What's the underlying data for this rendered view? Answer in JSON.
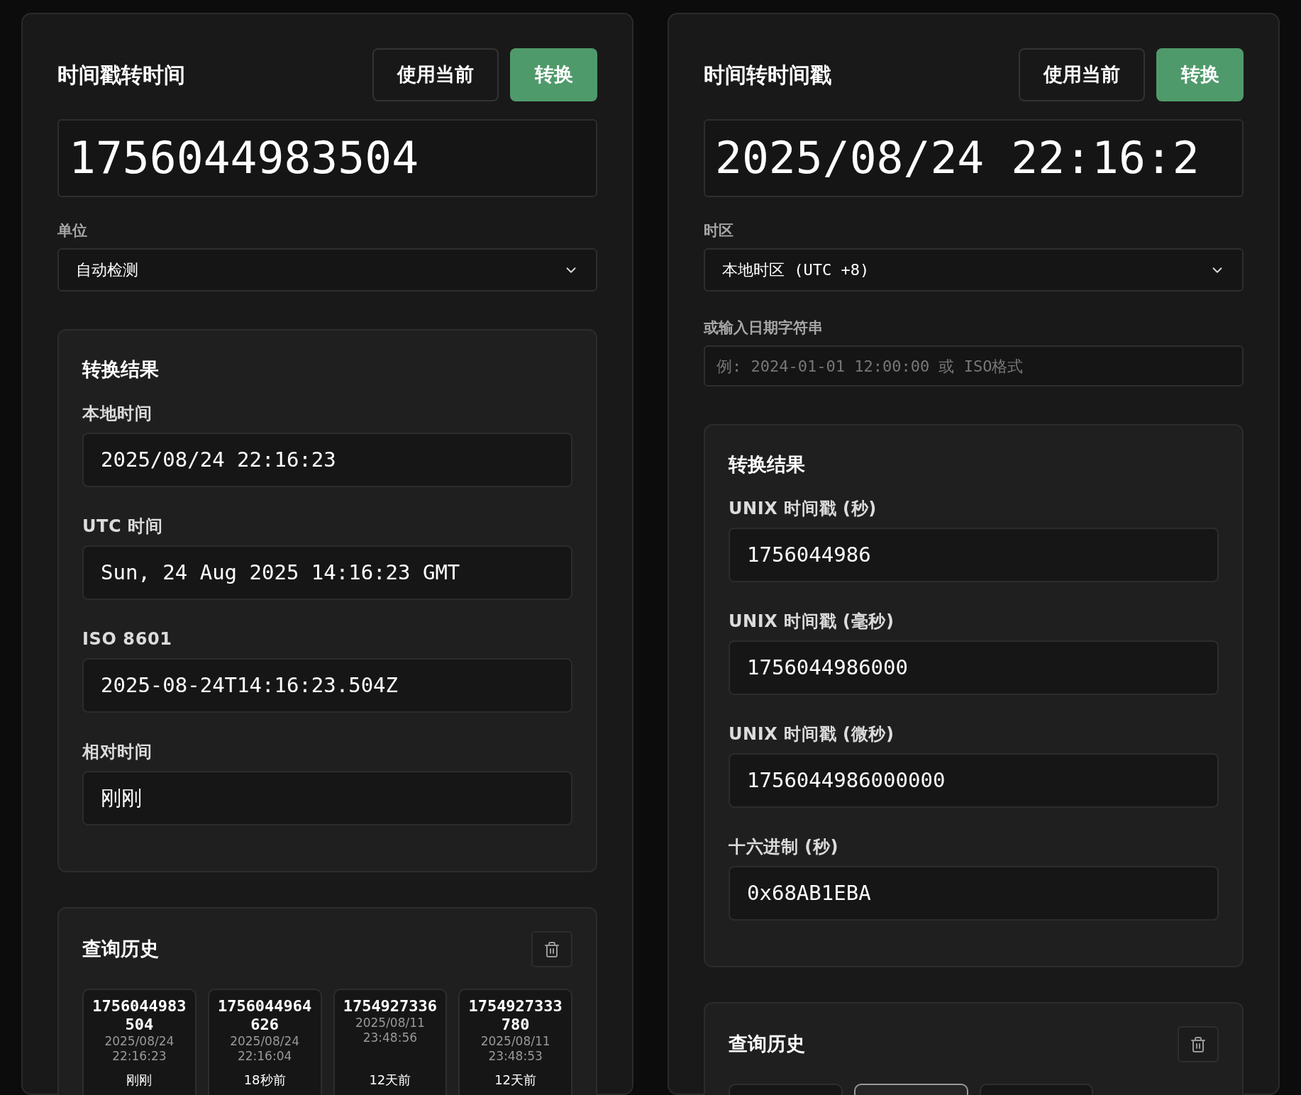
{
  "panels": [
    {
      "title": "时间戳转时间",
      "use_current_button": "使用当前",
      "convert_button": "转换",
      "main_input": {
        "value": "1756044983504"
      },
      "fields": [
        {
          "kind": "select",
          "label": "单位",
          "value": "自动检测"
        }
      ],
      "result": {
        "title": "转换结果",
        "rows": [
          {
            "label": "本地时间",
            "value": "2025/08/24 22:16:23"
          },
          {
            "label": "UTC 时间",
            "value": "Sun, 24 Aug 2025 14:16:23 GMT"
          },
          {
            "label": "ISO 8601",
            "value": "2025-08-24T14:16:23.504Z"
          },
          {
            "label": "相对时间",
            "value": "刚刚"
          }
        ]
      },
      "history": {
        "title": "查询历史",
        "items": [
          {
            "selected": false,
            "value": "1756044983504",
            "date": "2025/08/24",
            "time": "22:16:23",
            "ago": "刚刚"
          },
          {
            "selected": false,
            "value": "1756044964626",
            "date": "2025/08/24",
            "time": "22:16:04",
            "ago": "18秒前"
          },
          {
            "selected": false,
            "value": "1754927336",
            "date": "2025/08/11",
            "time": "23:48:56",
            "ago": "12天前"
          },
          {
            "selected": false,
            "value": "1754927333780",
            "date": "2025/08/11",
            "time": "23:48:53",
            "ago": "12天前"
          }
        ]
      }
    },
    {
      "title": "时间转时间戳",
      "use_current_button": "使用当前",
      "convert_button": "转换",
      "main_input": {
        "value": "2025/08/24 22:16:2"
      },
      "fields": [
        {
          "kind": "select",
          "label": "时区",
          "value": "本地时区 (UTC +8)"
        },
        {
          "kind": "input",
          "label": "或输入日期字符串",
          "placeholder": "例: 2024-01-01 12:00:00 或 ISO格式"
        }
      ],
      "result": {
        "title": "转换结果",
        "rows": [
          {
            "label": "UNIX 时间戳 (秒)",
            "value": "1756044986"
          },
          {
            "label": "UNIX 时间戳 (毫秒)",
            "value": "1756044986000"
          },
          {
            "label": "UNIX 时间戳 (微秒)",
            "value": "1756044986000000"
          },
          {
            "label": "十六进制 (秒)",
            "value": "0x68AB1EBA"
          }
        ]
      },
      "history": {
        "title": "查询历史",
        "items": [
          {
            "selected": false
          },
          {
            "selected": true
          },
          {
            "selected": false
          }
        ]
      }
    }
  ]
}
